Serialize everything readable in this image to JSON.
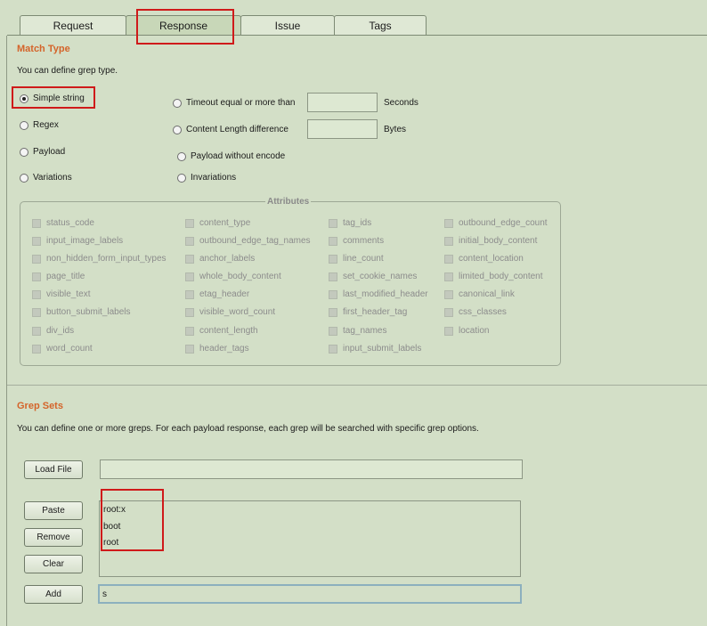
{
  "tabs": [
    "Request",
    "Response",
    "Issue",
    "Tags"
  ],
  "active_tab": "Response",
  "match_type": {
    "title": "Match Type",
    "description": "You can define grep type.",
    "options_left": [
      "Simple string",
      "Regex",
      "Payload",
      "Variations"
    ],
    "options_right": [
      "Timeout equal or more than",
      "Content Length difference",
      "Payload without encode",
      "Invariations"
    ],
    "selected": "Simple string",
    "timeout_value": "",
    "timeout_unit": "Seconds",
    "content_length_value": "",
    "content_length_unit": "Bytes"
  },
  "attributes": {
    "title": "Attributes",
    "col1": [
      "status_code",
      "input_image_labels",
      "non_hidden_form_input_types",
      "page_title",
      "visible_text",
      "button_submit_labels",
      "div_ids",
      "word_count"
    ],
    "col2": [
      "content_type",
      "outbound_edge_tag_names",
      "anchor_labels",
      "whole_body_content",
      "etag_header",
      "visible_word_count",
      "content_length",
      "header_tags"
    ],
    "col3": [
      "tag_ids",
      "comments",
      "line_count",
      "set_cookie_names",
      "last_modified_header",
      "first_header_tag",
      "tag_names",
      "input_submit_labels"
    ],
    "col4": [
      "outbound_edge_count",
      "initial_body_content",
      "content_location",
      "limited_body_content",
      "canonical_link",
      "css_classes",
      "location"
    ]
  },
  "grep_sets": {
    "title": "Grep Sets",
    "description": "You can define one or more greps. For each payload response, each grep will be searched with specific grep options.",
    "load_file_label": "Load File",
    "load_file_value": "",
    "paste_label": "Paste",
    "remove_label": "Remove",
    "clear_label": "Clear",
    "add_label": "Add",
    "items": [
      "root:x",
      "boot",
      "root"
    ],
    "add_value": "s"
  },
  "colors": {
    "background": "#d3dfc7",
    "section_title": "#d4642a",
    "highlight": "#cf1a1a"
  }
}
